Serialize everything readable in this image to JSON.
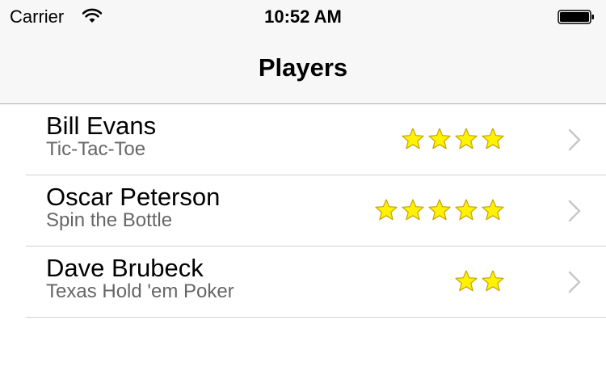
{
  "status_bar": {
    "carrier": "Carrier",
    "time": "10:52 AM",
    "wifi_icon": "wifi-icon",
    "battery_icon": "battery-icon"
  },
  "nav": {
    "title": "Players"
  },
  "colors": {
    "star_fill": "#FFF200",
    "star_stroke": "#C8A400",
    "chevron": "#c7c7cc",
    "separator": "#d0d0d4",
    "subtitle": "#666666"
  },
  "players": [
    {
      "name": "Bill Evans",
      "game": "Tic-Tac-Toe",
      "rating": 4
    },
    {
      "name": "Oscar Peterson",
      "game": "Spin the Bottle",
      "rating": 5
    },
    {
      "name": "Dave Brubeck",
      "game": "Texas Hold 'em Poker",
      "rating": 2
    }
  ]
}
